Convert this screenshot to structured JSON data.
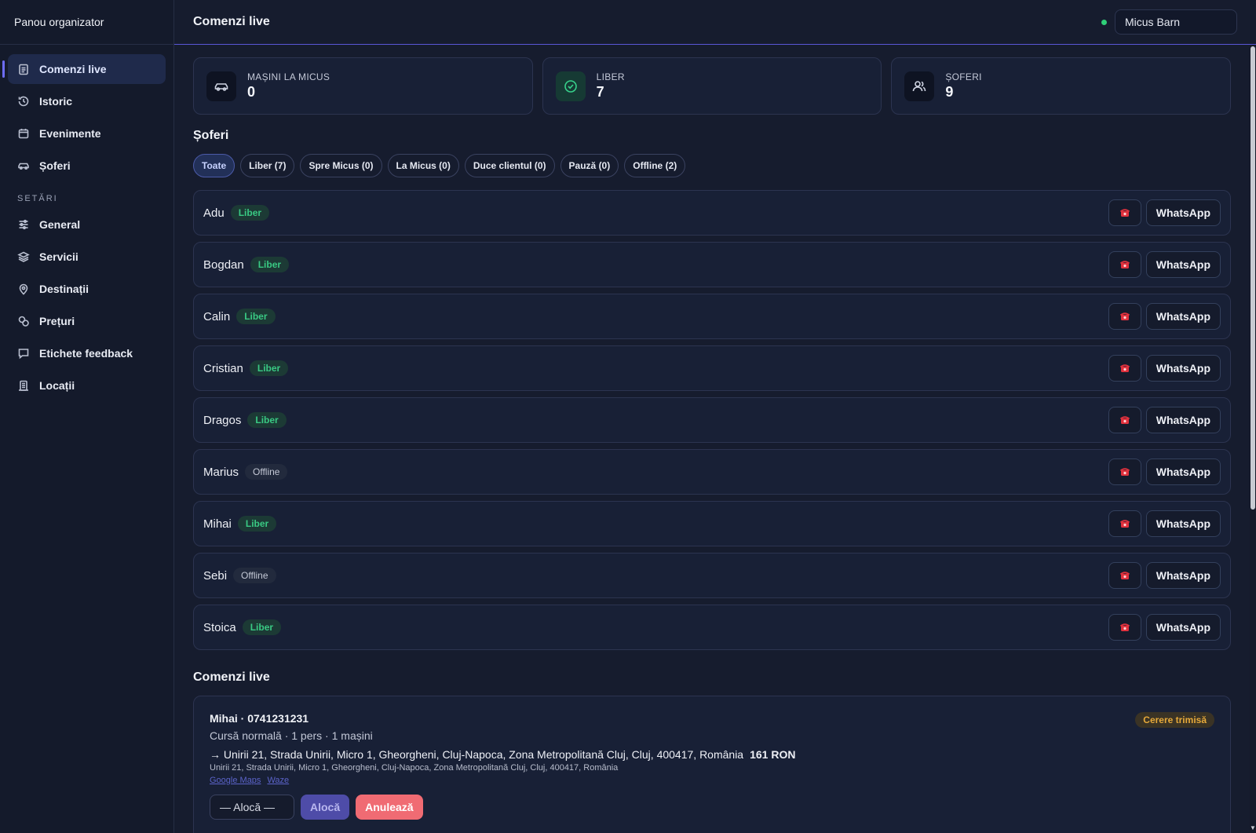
{
  "brand": "Panou organizator",
  "nav": {
    "items": [
      {
        "label": "Comenzi live",
        "icon": "clipboard-icon"
      },
      {
        "label": "Istoric",
        "icon": "history-icon"
      },
      {
        "label": "Evenimente",
        "icon": "calendar-icon"
      },
      {
        "label": "Șoferi",
        "icon": "car-icon"
      }
    ],
    "settings_label": "SETĂRI",
    "settings_items": [
      {
        "label": "General",
        "icon": "sliders-icon"
      },
      {
        "label": "Servicii",
        "icon": "layers-icon"
      },
      {
        "label": "Destinații",
        "icon": "map-pin-icon"
      },
      {
        "label": "Prețuri",
        "icon": "coins-icon"
      },
      {
        "label": "Etichete feedback",
        "icon": "message-icon"
      },
      {
        "label": "Locații",
        "icon": "building-icon"
      }
    ]
  },
  "header": {
    "title": "Comenzi live",
    "location": "Micus Barn",
    "status_color": "#2fcf78"
  },
  "stats": [
    {
      "label": "MAȘINI LA MICUS",
      "value": "0",
      "icon": "car-icon"
    },
    {
      "label": "LIBER",
      "value": "7",
      "icon": "check-circle-icon"
    },
    {
      "label": "ȘOFERI",
      "value": "9",
      "icon": "users-icon"
    }
  ],
  "drivers_section": {
    "title": "Șoferi",
    "filters": [
      "Toate",
      "Liber (7)",
      "Spre Micus (0)",
      "La Micus (0)",
      "Duce clientul (0)",
      "Pauză (0)",
      "Offline (2)"
    ],
    "call_icon": "phone-icon",
    "whatsapp_label": "WhatsApp",
    "rows": [
      {
        "name": "Adu",
        "status": "Liber"
      },
      {
        "name": "Bogdan",
        "status": "Liber"
      },
      {
        "name": "Calin",
        "status": "Liber"
      },
      {
        "name": "Cristian",
        "status": "Liber"
      },
      {
        "name": "Dragos",
        "status": "Liber"
      },
      {
        "name": "Marius",
        "status": "Offline"
      },
      {
        "name": "Mihai",
        "status": "Liber"
      },
      {
        "name": "Sebi",
        "status": "Offline"
      },
      {
        "name": "Stoica",
        "status": "Liber"
      }
    ]
  },
  "orders_section": {
    "title": "Comenzi live",
    "order": {
      "head": "Mihai · 0741231231",
      "sub": "Cursă normală · 1 pers · 1 mașini",
      "route": "→ Unirii 21, Strada Unirii, Micro 1, Gheorgheni, Cluj-Napoca, Zona Metropolitană Cluj, Cluj, 400417, România",
      "price": "161 RON",
      "address": "Unirii 21, Strada Unirii, Micro 1, Gheorgheni, Cluj-Napoca, Zona Metropolitană Cluj, Cluj, 400417, România",
      "link_google": "Google Maps",
      "link_waze": "Waze",
      "status": "Cerere trimisă",
      "assign_placeholder": "— Alocă —",
      "assign_button": "Alocă",
      "cancel_button": "Anulează"
    }
  },
  "colors": {
    "accent": "#6d6cf6",
    "liber": "#39c983",
    "pending": "#e6a93a",
    "danger": "#f06b73"
  }
}
